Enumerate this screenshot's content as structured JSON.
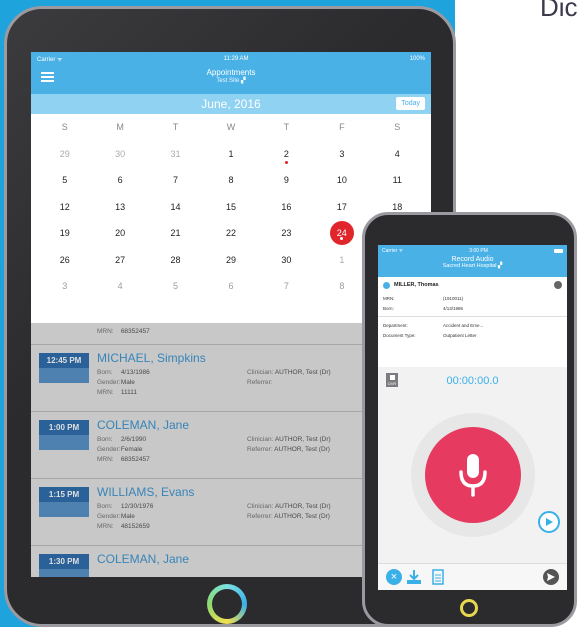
{
  "headline": "Dic",
  "tablet": {
    "status": {
      "carrier": "Carrier ᯤ",
      "time": "11:29 AM",
      "battery": "100%"
    },
    "nav": {
      "title": "Appointments",
      "subtitle": "Test Site"
    },
    "month": "June, 2016",
    "today_label": "Today",
    "weekdays": [
      "S",
      "M",
      "T",
      "W",
      "T",
      "F",
      "S"
    ],
    "weeks": [
      [
        "29",
        "30",
        "31",
        "1",
        "2",
        "3",
        "4"
      ],
      [
        "5",
        "6",
        "7",
        "8",
        "9",
        "10",
        "11"
      ],
      [
        "12",
        "13",
        "14",
        "15",
        "16",
        "17",
        "18"
      ],
      [
        "19",
        "20",
        "21",
        "22",
        "23",
        "24",
        ""
      ],
      [
        "26",
        "27",
        "28",
        "29",
        "30",
        "1",
        ""
      ],
      [
        "3",
        "4",
        "5",
        "6",
        "7",
        "8",
        ""
      ]
    ],
    "selected_day": "24",
    "first_row": {
      "mrn_label": "MRN:",
      "mrn": "68352457"
    },
    "appointments": [
      {
        "time": "12:45 PM",
        "name": "MICHAEL, Simpkins",
        "born": "4/13/1986",
        "gender": "Male",
        "mrn": "11111",
        "clinician": "AUTHOR, Test (Dr)",
        "referrer": ""
      },
      {
        "time": "1:00 PM",
        "name": "COLEMAN, Jane",
        "born": "2/6/1990",
        "gender": "Female",
        "mrn": "68352457",
        "clinician": "AUTHOR, Test (Dr)",
        "referrer": "AUTHOR, Test (Dr)"
      },
      {
        "time": "1:15 PM",
        "name": "WILLIAMS, Evans",
        "born": "12/30/1976",
        "gender": "Male",
        "mrn": "48152659",
        "clinician": "AUTHOR, Test (Dr)",
        "referrer": "AUTHOR, Test (Dr)"
      },
      {
        "time": "1:30 PM",
        "name": "COLEMAN, Jane",
        "born": "",
        "gender": "",
        "mrn": "",
        "clinician": "",
        "referrer": ""
      }
    ],
    "labels": {
      "born": "Born:",
      "gender": "Gender:",
      "mrn": "MRN:",
      "clinician": "Clinician:",
      "referrer": "Referrer:"
    }
  },
  "phone": {
    "status": {
      "carrier": "Carrier ᯤ",
      "time": "3:00 PM"
    },
    "nav": {
      "title": "Record Audio",
      "subtitle": "Sacred Heart Hospital"
    },
    "patient_name": "MILLER, Thomas",
    "rows": [
      {
        "k": "MRN:",
        "v": "(1910011)"
      },
      {
        "k": "Born:",
        "v": "4/13/1986"
      },
      {
        "k": "Department:",
        "v": "Accident and Eme..."
      },
      {
        "k": "Document Type:",
        "v": "Outpatient Letter"
      }
    ],
    "ovr_label": "OVR",
    "timer": "00:00:00.0"
  },
  "colors": {
    "brand": "#4ab1e6",
    "record": "#e63a61",
    "selected": "#e0262b",
    "background": "#1ea3dc"
  }
}
